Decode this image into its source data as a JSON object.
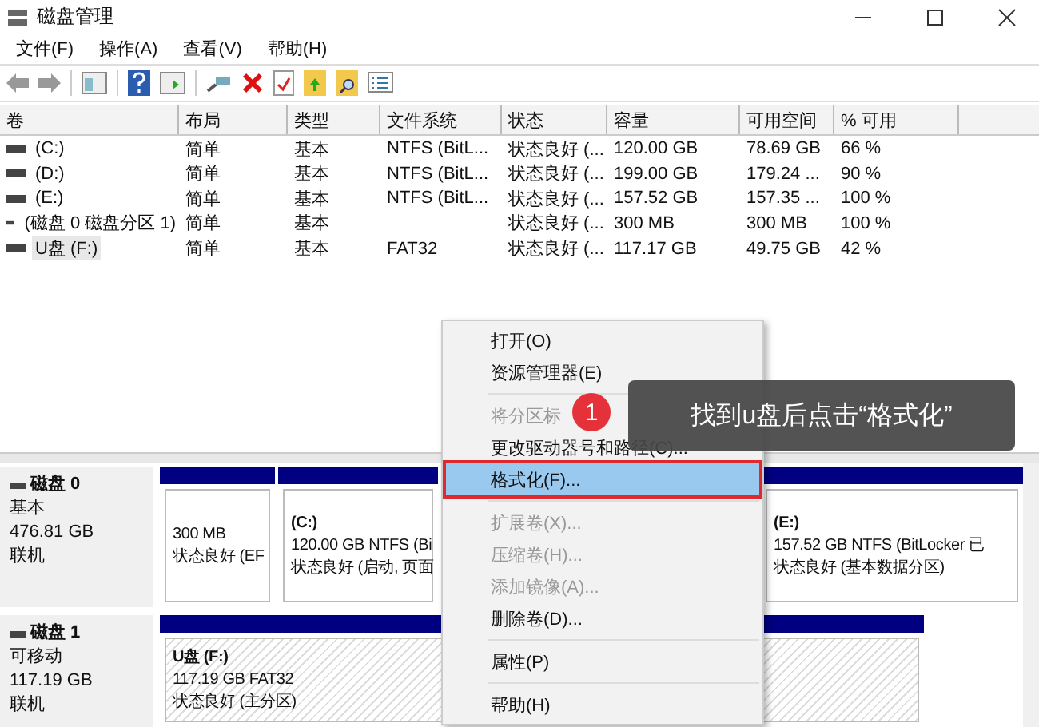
{
  "window": {
    "title": "磁盘管理"
  },
  "menu": [
    "文件(F)",
    "操作(A)",
    "查看(V)",
    "帮助(H)"
  ],
  "table": {
    "columns": [
      "卷",
      "布局",
      "类型",
      "文件系统",
      "状态",
      "容量",
      "可用空间",
      "% 可用"
    ],
    "rows": [
      {
        "selected": false,
        "cells": [
          "(C:)",
          "简单",
          "基本",
          "NTFS (BitL...",
          "状态良好 (...",
          "120.00 GB",
          "78.69 GB",
          "66 %"
        ]
      },
      {
        "selected": false,
        "cells": [
          "(D:)",
          "简单",
          "基本",
          "NTFS (BitL...",
          "状态良好 (...",
          "199.00 GB",
          "179.24 ...",
          "90 %"
        ]
      },
      {
        "selected": false,
        "cells": [
          "(E:)",
          "简单",
          "基本",
          "NTFS (BitL...",
          "状态良好 (...",
          "157.52 GB",
          "157.35 ...",
          "100 %"
        ]
      },
      {
        "selected": false,
        "cells": [
          "(磁盘 0 磁盘分区 1)",
          "简单",
          "基本",
          "",
          "状态良好 (...",
          "300 MB",
          "300 MB",
          "100 %"
        ]
      },
      {
        "selected": true,
        "cells": [
          "U盘 (F:)",
          "简单",
          "基本",
          "FAT32",
          "状态良好 (...",
          "117.17 GB",
          "49.75 GB",
          "42 %"
        ]
      }
    ]
  },
  "disks": [
    {
      "name": "磁盘 0",
      "type": "基本",
      "size": "476.81 GB",
      "status": "联机",
      "partitions": [
        {
          "kind": "plain",
          "detail": "300 MB",
          "status": "状态良好 (EF"
        },
        {
          "kind": "plain",
          "label": "(C:)",
          "detail": "120.00 GB NTFS (Bi",
          "status": "状态良好 (启动, 页面"
        },
        {
          "kind": "gap"
        },
        {
          "kind": "plain",
          "label": "(E:)",
          "detail": "157.52 GB NTFS (BitLocker 已",
          "status": "状态良好 (基本数据分区)"
        }
      ]
    },
    {
      "name": "磁盘 1",
      "type": "可移动",
      "size": "117.19 GB",
      "status": "联机",
      "partitions": [
        {
          "kind": "hatched",
          "label": "U盘  (F:)",
          "detail": "117.19 GB FAT32",
          "status": "状态良好 (主分区)"
        }
      ]
    }
  ],
  "context_menu": [
    {
      "kind": "item",
      "label": "打开(O)",
      "disabled": false,
      "selected": false
    },
    {
      "kind": "item",
      "label": "资源管理器(E)",
      "disabled": false,
      "selected": false
    },
    {
      "kind": "separator"
    },
    {
      "kind": "item",
      "label": "将分区标",
      "disabled": true,
      "selected": false
    },
    {
      "kind": "item",
      "label": "更改驱动器号和路径(C)...",
      "disabled": false,
      "selected": false
    },
    {
      "kind": "item",
      "label": "格式化(F)...",
      "disabled": false,
      "selected": true
    },
    {
      "kind": "separator"
    },
    {
      "kind": "item",
      "label": "扩展卷(X)...",
      "disabled": true,
      "selected": false
    },
    {
      "kind": "item",
      "label": "压缩卷(H)...",
      "disabled": true,
      "selected": false
    },
    {
      "kind": "item",
      "label": "添加镜像(A)...",
      "disabled": true,
      "selected": false
    },
    {
      "kind": "item",
      "label": "删除卷(D)...",
      "disabled": false,
      "selected": false
    },
    {
      "kind": "separator"
    },
    {
      "kind": "item",
      "label": "属性(P)",
      "disabled": false,
      "selected": false
    },
    {
      "kind": "separator"
    },
    {
      "kind": "item",
      "label": "帮助(H)",
      "disabled": false,
      "selected": false
    }
  ],
  "callout": {
    "badge": "1",
    "text": "找到u盘后点击“格式化”"
  }
}
